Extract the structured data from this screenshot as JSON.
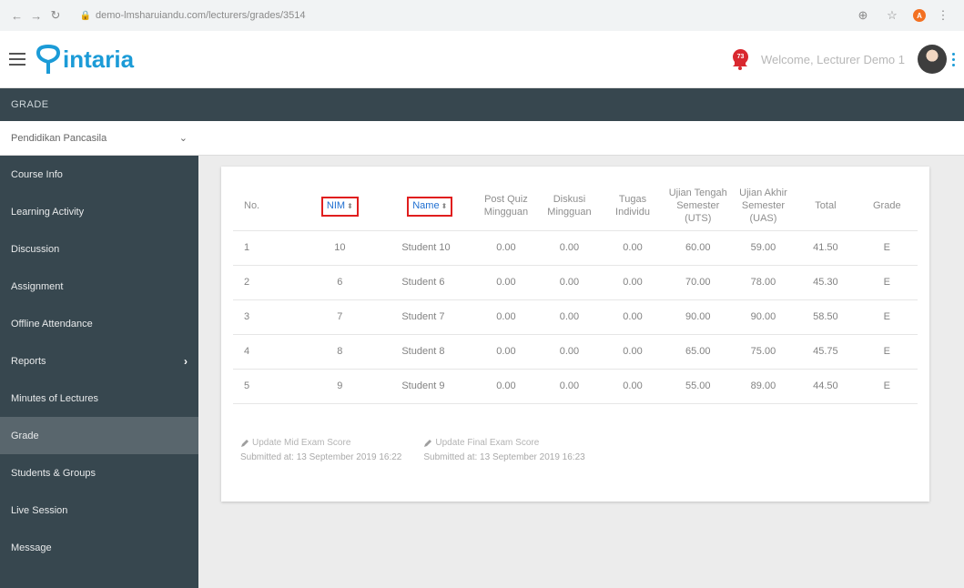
{
  "browser": {
    "url": "demo-lmsharuiandu.com/lecturers/grades/3514"
  },
  "header": {
    "logo_text": "intaria",
    "notification_count": "73",
    "welcome_text": "Welcome, Lecturer Demo 1"
  },
  "grade_bar": {
    "title": "GRADE"
  },
  "course_select": {
    "value": "Pendidikan Pancasila"
  },
  "sidebar": {
    "items": [
      {
        "label": "Course Info"
      },
      {
        "label": "Learning Activity"
      },
      {
        "label": "Discussion"
      },
      {
        "label": "Assignment"
      },
      {
        "label": "Offline Attendance"
      },
      {
        "label": "Reports"
      },
      {
        "label": "Minutes of Lectures"
      },
      {
        "label": "Grade"
      },
      {
        "label": "Students & Groups"
      },
      {
        "label": "Live Session"
      },
      {
        "label": "Message"
      }
    ]
  },
  "table": {
    "headers": {
      "no": "No.",
      "nim": "NIM",
      "name": "Name",
      "post_quiz_1": "Post Quiz",
      "post_quiz_2": "Mingguan",
      "diskusi_1": "Diskusi",
      "diskusi_2": "Mingguan",
      "tugas_1": "Tugas",
      "tugas_2": "Individu",
      "uts_1": "Ujian Tengah",
      "uts_2": "Semester",
      "uts_3": "(UTS)",
      "uas_1": "Ujian Akhir",
      "uas_2": "Semester",
      "uas_3": "(UAS)",
      "total": "Total",
      "grade": "Grade"
    },
    "rows": [
      {
        "no": "1",
        "nim": "10",
        "name": "Student 10",
        "post_quiz": "0.00",
        "diskusi": "0.00",
        "tugas": "0.00",
        "uts": "60.00",
        "uas": "59.00",
        "total": "41.50",
        "grade": "E"
      },
      {
        "no": "2",
        "nim": "6",
        "name": "Student 6",
        "post_quiz": "0.00",
        "diskusi": "0.00",
        "tugas": "0.00",
        "uts": "70.00",
        "uas": "78.00",
        "total": "45.30",
        "grade": "E"
      },
      {
        "no": "3",
        "nim": "7",
        "name": "Student 7",
        "post_quiz": "0.00",
        "diskusi": "0.00",
        "tugas": "0.00",
        "uts": "90.00",
        "uas": "90.00",
        "total": "58.50",
        "grade": "E"
      },
      {
        "no": "4",
        "nim": "8",
        "name": "Student 8",
        "post_quiz": "0.00",
        "diskusi": "0.00",
        "tugas": "0.00",
        "uts": "65.00",
        "uas": "75.00",
        "total": "45.75",
        "grade": "E"
      },
      {
        "no": "5",
        "nim": "9",
        "name": "Student 9",
        "post_quiz": "0.00",
        "diskusi": "0.00",
        "tugas": "0.00",
        "uts": "55.00",
        "uas": "89.00",
        "total": "44.50",
        "grade": "E"
      }
    ]
  },
  "updates": {
    "mid_label": "Update Mid Exam Score",
    "mid_submitted": "Submitted at: 13 September 2019 16:22",
    "final_label": "Update Final Exam Score",
    "final_submitted": "Submitted at: 13 September 2019 16:23"
  },
  "colors": {
    "brand": "#1b9bd7",
    "sidebar_bg": "#37474f",
    "sidebar_active": "#59666d",
    "highlight_border": "#e01e1e",
    "notification": "#d9282f"
  }
}
